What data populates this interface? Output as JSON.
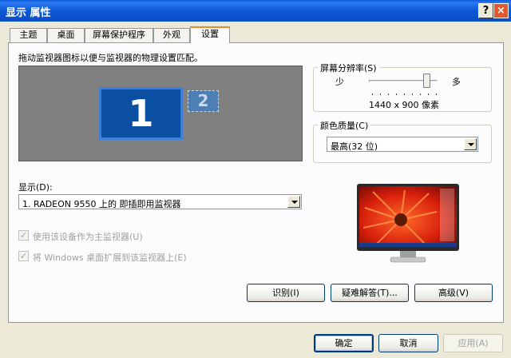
{
  "window": {
    "title": "显示 属性",
    "help_label": "?",
    "close_label": "×"
  },
  "tabs": [
    {
      "label": "主题"
    },
    {
      "label": "桌面"
    },
    {
      "label": "屏幕保护程序"
    },
    {
      "label": "外观"
    },
    {
      "label": "设置"
    }
  ],
  "settings": {
    "instruction": "拖动监视器图标以便与监视器的物理设置匹配。",
    "monitor1_label": "1",
    "monitor2_label": "2",
    "resolution": {
      "legend": "屏幕分辨率(S)",
      "min_label": "少",
      "max_label": "多",
      "value_text": "1440 x 900 像素",
      "slider_level": 0.88
    },
    "color_quality": {
      "legend": "颜色质量(C)",
      "selected": "最高(32 位)"
    },
    "display": {
      "label": "显示(D):",
      "selected": "1. RADEON 9550  上的 即插即用监视器"
    },
    "primary_checkbox_label": "使用该设备作为主监视器(U)",
    "extend_checkbox_label": "将 Windows 桌面扩展到该监视器上(E)",
    "identify_button": "识别(I)",
    "troubleshoot_button": "疑难解答(T)...",
    "advanced_button": "高级(V)"
  },
  "footer": {
    "ok_button": "确定",
    "cancel_button": "取消",
    "apply_button": "应用(A)"
  },
  "colors": {
    "title_bar": "#0a58d6",
    "monitor_primary": "#0a4fa2",
    "dialog_bg": "#ece9d8"
  }
}
